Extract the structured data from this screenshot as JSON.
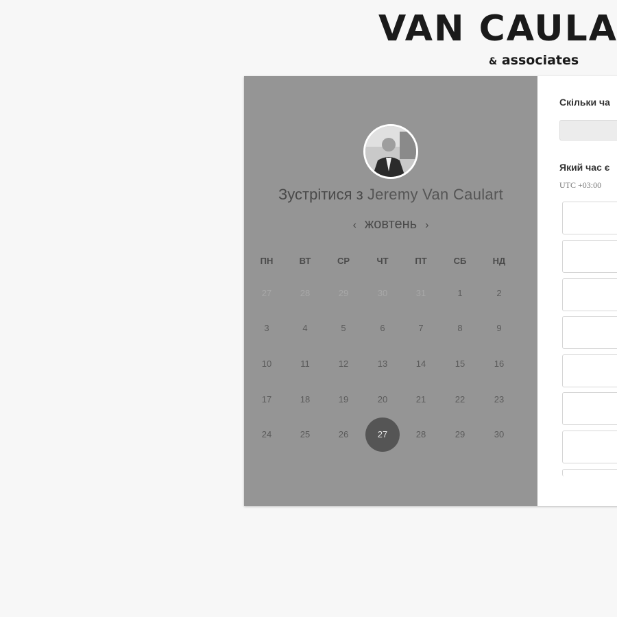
{
  "brand": {
    "name": "VAN CAULA",
    "sub_amp": "&",
    "sub_text": "associates"
  },
  "booking": {
    "title_prefix": "Зустрітися з",
    "host_name": "Jeremy Van Caulart",
    "month": "жовтень",
    "prev_icon": "‹",
    "next_icon": "›",
    "weekdays": [
      "ПН",
      "ВТ",
      "СР",
      "ЧТ",
      "ПТ",
      "СБ",
      "НД"
    ],
    "days": [
      [
        "27",
        "28",
        "29",
        "30",
        "31",
        "1",
        "2"
      ],
      [
        "3",
        "4",
        "5",
        "6",
        "7",
        "8",
        "9"
      ],
      [
        "10",
        "11",
        "12",
        "13",
        "14",
        "15",
        "16"
      ],
      [
        "17",
        "18",
        "19",
        "20",
        "21",
        "22",
        "23"
      ],
      [
        "24",
        "25",
        "26",
        "27",
        "28",
        "29",
        "30"
      ]
    ],
    "muted_first_row_count": 5,
    "selected_day": "27"
  },
  "right_panel": {
    "duration_question": "Скільки ча",
    "time_question": "Який час є",
    "timezone": "UTC +03:00"
  },
  "colors": {
    "left_panel": "#959595",
    "selected_day": "#555555"
  }
}
